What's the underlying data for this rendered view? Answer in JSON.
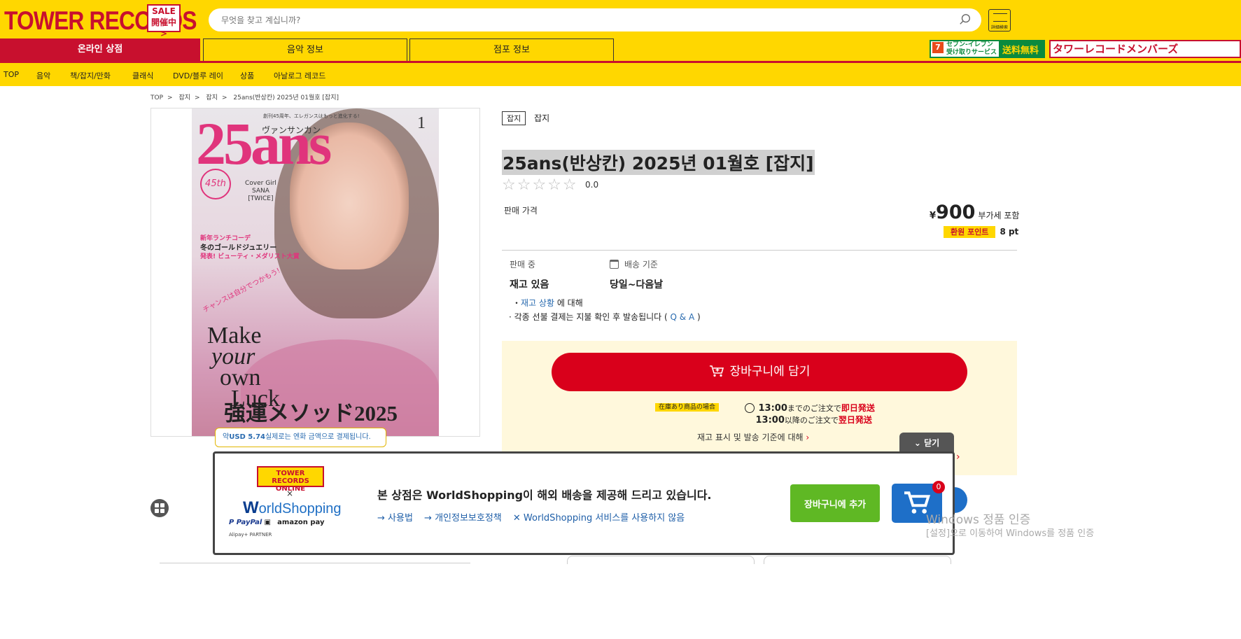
{
  "header": {
    "logo": "TOWER RECORDS",
    "sale_line1": "SALE",
    "sale_line2": "開催中>",
    "search_placeholder": "무엇을 찾고 계십니까?",
    "detail_search": "詳細検索"
  },
  "nav": {
    "online": "온라인 상점",
    "music": "음악 정보",
    "store": "점포 정보",
    "banner_711_text": "セブン-イレブン受け取りサービス",
    "banner_711_free": "送料無料",
    "banner_tr": "タワーレコードメンバーズ"
  },
  "categories": [
    "TOP",
    "음악",
    "책/잡지/만화",
    "클래식",
    "DVD/블루 레이",
    "상품",
    "아날로그 레코드"
  ],
  "breadcrumb": [
    "TOP",
    "잡지",
    "잡지",
    "25ans(반상칸) 2025년 01월호 [잡지]"
  ],
  "cover": {
    "title": "25ans",
    "kana": "ヴァンサンカン",
    "topline": "創刊45周年、エレガンスはもっと進化する!",
    "issue": "1",
    "anniv": "45th",
    "cover_girl": "Cover Girl",
    "sana": "SANA",
    "twice": "[TWICE]",
    "h1": "新年ランチコーデ",
    "h2": "冬のゴールドジュエリー",
    "h3": "発表! ビューティ・メダリスト大賞",
    "chance": "チャンスは自分でつかもう!",
    "make": "Make",
    "your": "your",
    "own": "own",
    "luck": "Luck",
    "kyoun": "強運メソッド2025"
  },
  "product": {
    "category_tag": "잡지",
    "category": "잡지",
    "title": "25ans(반상칸) 2025년 01월호 [잡지]",
    "stars": "☆☆☆☆☆",
    "rating": "0.0",
    "price_label": "판매 가격",
    "yen": "¥",
    "price": "900",
    "tax": "부가세 포함",
    "points_label": "환원 포인트",
    "points": "8 pt",
    "stock_label": "판매 중",
    "ship_label": "배송 기준",
    "stock_value": "재고 있음",
    "ship_value": "당일~다음날",
    "note1_bullet": "・",
    "note1_link": "재고 상황",
    "note1_rest": " 에 대해",
    "note2_text": "· 각종 선불 결제는 지불 확인 후 발송됩니다 (",
    "note2_link": " Q & A ",
    "note2_end": ")"
  },
  "cart": {
    "button": "장바구니에 담기",
    "stock_badge": "在庫あり商品の場合",
    "time1": "13:00",
    "text1": "までのご注文で",
    "red1": "即日発送",
    "time2": "13:00",
    "text2": "以降のご注文で",
    "red2": "翌日発送",
    "stock_info": "재고 표시 및 발송 기준에 대해"
  },
  "usd_tip": {
    "prefix": "약",
    "amount": "USD 5.74",
    "suffix": "실제로는 엔화 금액으로 결제됩니다."
  },
  "worldshopping": {
    "close": "닫기",
    "tr_logo1": "TOWER RECORDS",
    "tr_logo2": "ONLINE",
    "x": "×",
    "ws_w": "W",
    "ws_rest": "orldShopping",
    "paypal": "P PayPal",
    "amazon": "amazon pay",
    "alipay": "Alipay+ PARTNER",
    "message": "본 상점은 WorldShopping이 해외 배송을 제공해 드리고 있습니다.",
    "link1": "→ 사용법",
    "link2": "→ 개인정보보호정책",
    "link3": "✕ WorldShopping 서비스를 사용하지 않음",
    "add_button": "장바구니에 추가",
    "cart_count": "0"
  },
  "watermark": {
    "line1": "Windows 정품 인증",
    "line2": "[설정]으로 이동하여 Windows를 정품 인증"
  }
}
